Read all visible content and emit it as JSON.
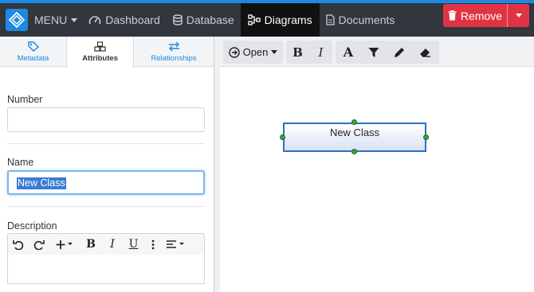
{
  "nav": {
    "menu_label": "MENU",
    "items": [
      {
        "label": "Dashboard",
        "icon": "gauge-icon"
      },
      {
        "label": "Database",
        "icon": "database-icon"
      },
      {
        "label": "Diagrams",
        "icon": "diagram-icon",
        "active": true
      },
      {
        "label": "Documents",
        "icon": "document-icon"
      }
    ]
  },
  "tabs": [
    {
      "label": "Metadata",
      "icon": "tag-icon"
    },
    {
      "label": "Attributes",
      "icon": "cubes-icon",
      "active": true
    },
    {
      "label": "Relationships",
      "icon": "exchange-icon"
    }
  ],
  "form": {
    "number": {
      "label": "Number",
      "value": ""
    },
    "name": {
      "label": "Name",
      "value": "New Class"
    },
    "description": {
      "label": "Description",
      "value": ""
    }
  },
  "toolbar": {
    "open_label": "Open",
    "remove_label": "Remove"
  },
  "canvas": {
    "node_label": "New Class"
  },
  "colors": {
    "accent": "#1e88e5",
    "navbar": "#32373d",
    "active_nav": "#0f1113",
    "remove": "#e03444",
    "node_border": "#2d6fc4",
    "handle": "#39a53a"
  }
}
